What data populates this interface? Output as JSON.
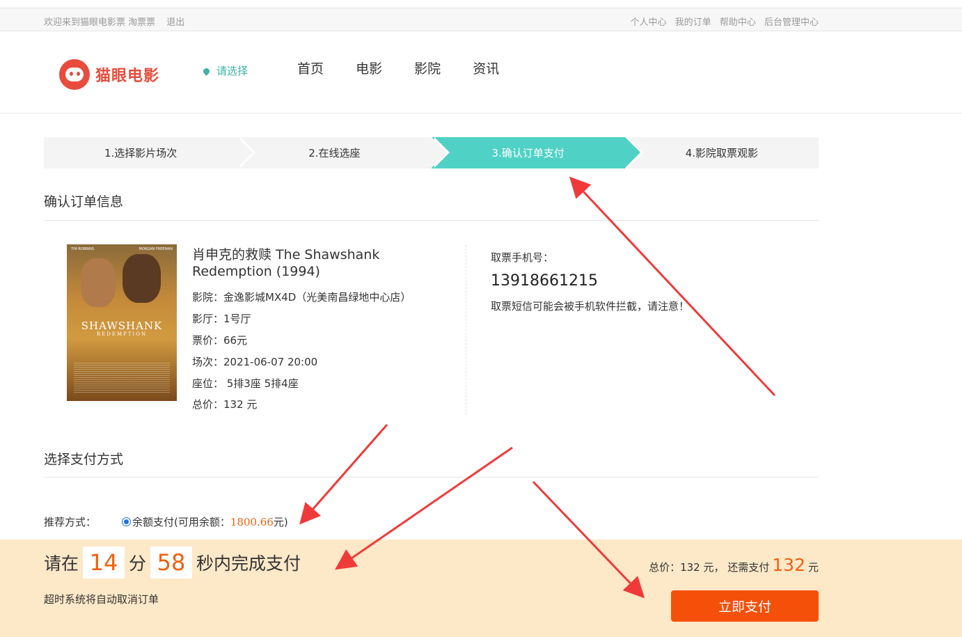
{
  "topbar": {
    "welcome": "欢迎来到猫眼电影票 淘票票",
    "logout": "退出",
    "links": [
      "个人中心",
      "我的订单",
      "帮助中心",
      "后台管理中心"
    ]
  },
  "header": {
    "logo_text": "猫眼电影",
    "city": "请选择",
    "nav": [
      "首页",
      "电影",
      "影院",
      "资讯"
    ]
  },
  "steps": [
    "1.选择影片场次",
    "2.在线选座",
    "3.确认订单支付",
    "4.影院取票观影"
  ],
  "order": {
    "section_title": "确认订单信息",
    "poster": {
      "actor_left": "TIM ROBBINS",
      "actor_right": "MORGAN FREEMAN",
      "title": "SHAWSHANK",
      "subtitle": "REDEMPTION"
    },
    "movie_title": "肖申克的救赎 The Shawshank Redemption (1994)",
    "cinema": "影院：金逸影城MX4D（光美南昌绿地中心店）",
    "hall": "影厅：1号厅",
    "price": "票价：66元",
    "showtime": "场次：2021-06-07 20:00",
    "seats": "座位： 5排3座 5排4座",
    "total": "总价：132 元",
    "phone_label": "取票手机号：",
    "phone": "13918661215",
    "phone_tip": "取票短信可能会被手机软件拦截，请注意！"
  },
  "payment": {
    "section_title": "选择支付方式",
    "rec_label": "推荐方式：",
    "option_prefix": "余额支付(可用余额：",
    "balance": "1800.66",
    "option_suffix": "元)"
  },
  "paybar": {
    "prefix": "请在",
    "minutes": "14",
    "min_unit": "分",
    "seconds": "58",
    "suffix": "秒内完成支付",
    "note": "超时系统将自动取消订单",
    "total_text": "总价：132 元， 还需支付",
    "amount": "132",
    "unit": "元",
    "button": "立即支付"
  },
  "colors": {
    "accent_teal": "#4fd1c5",
    "accent_orange": "#f5500a",
    "annotation_red": "#f03a3a"
  }
}
